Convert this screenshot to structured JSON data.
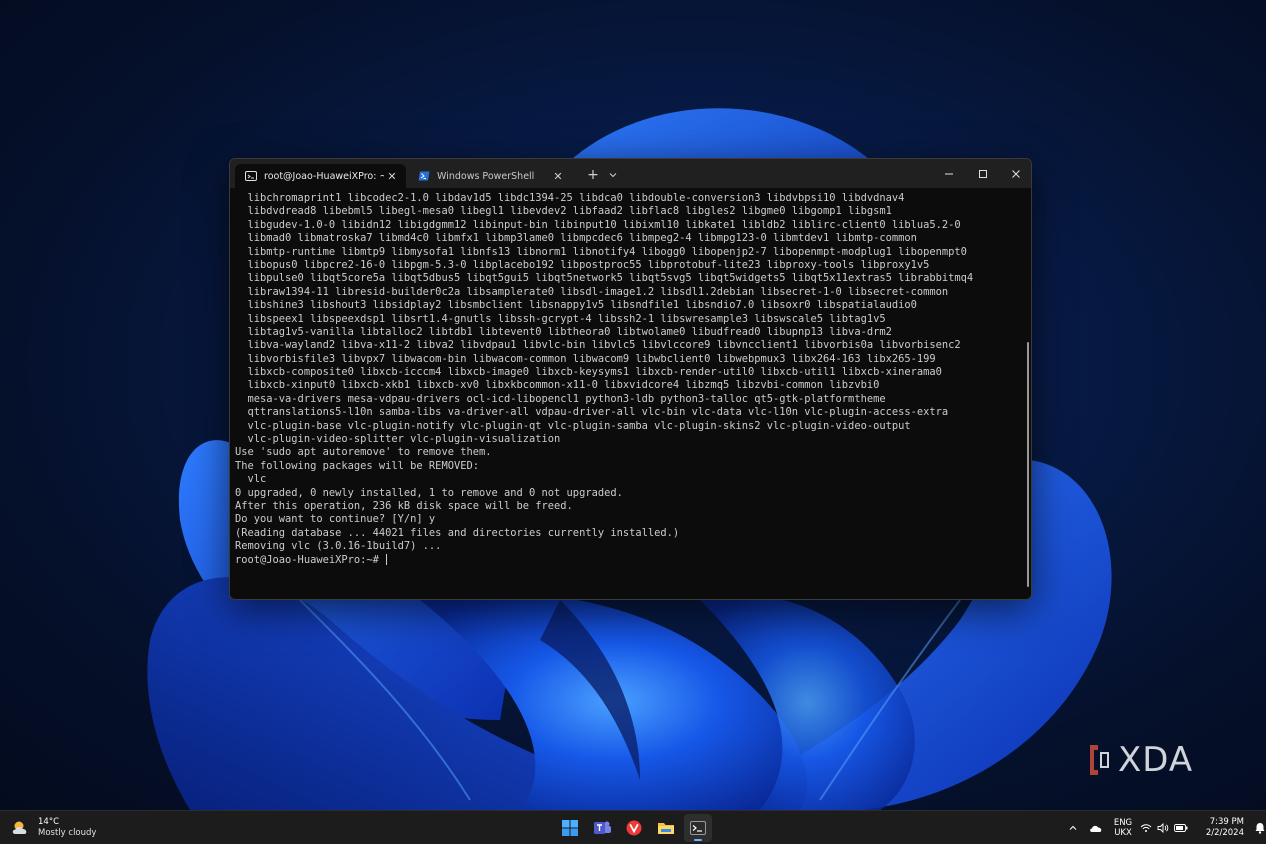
{
  "terminal": {
    "tabs": [
      {
        "label": "root@Joao-HuaweiXPro: ~",
        "active": true
      },
      {
        "label": "Windows PowerShell",
        "active": false
      }
    ],
    "new_tab_label": "+",
    "lines": [
      "  libchromaprint1 libcodec2-1.0 libdav1d5 libdc1394-25 libdca0 libdouble-conversion3 libdvbpsi10 libdvdnav4",
      "  libdvdread8 libebml5 libegl-mesa0 libegl1 libevdev2 libfaad2 libflac8 libgles2 libgme0 libgomp1 libgsm1",
      "  libgudev-1.0-0 libidn12 libigdgmm12 libinput-bin libinput10 libixml10 libkate1 libldb2 liblirc-client0 liblua5.2-0",
      "  libmad0 libmatroska7 libmd4c0 libmfx1 libmp3lame0 libmpcdec6 libmpeg2-4 libmpg123-0 libmtdev1 libmtp-common",
      "  libmtp-runtime libmtp9 libmysofa1 libnfs13 libnorm1 libnotify4 libogg0 libopenjp2-7 libopenmpt-modplug1 libopenmpt0",
      "  libopus0 libpcre2-16-0 libpgm-5.3-0 libplacebo192 libpostproc55 libprotobuf-lite23 libproxy-tools libproxy1v5",
      "  libpulse0 libqt5core5a libqt5dbus5 libqt5gui5 libqt5network5 libqt5svg5 libqt5widgets5 libqt5x11extras5 librabbitmq4",
      "  libraw1394-11 libresid-builder0c2a libsamplerate0 libsdl-image1.2 libsdl1.2debian libsecret-1-0 libsecret-common",
      "  libshine3 libshout3 libsidplay2 libsmbclient libsnappy1v5 libsndfile1 libsndio7.0 libsoxr0 libspatialaudio0",
      "  libspeex1 libspeexdsp1 libsrt1.4-gnutls libssh-gcrypt-4 libssh2-1 libswresample3 libswscale5 libtag1v5",
      "  libtag1v5-vanilla libtalloc2 libtdb1 libtevent0 libtheora0 libtwolame0 libudfread0 libupnp13 libva-drm2",
      "  libva-wayland2 libva-x11-2 libva2 libvdpau1 libvlc-bin libvlc5 libvlccore9 libvncclient1 libvorbis0a libvorbisenc2",
      "  libvorbisfile3 libvpx7 libwacom-bin libwacom-common libwacom9 libwbclient0 libwebpmux3 libx264-163 libx265-199",
      "  libxcb-composite0 libxcb-icccm4 libxcb-image0 libxcb-keysyms1 libxcb-render-util0 libxcb-util1 libxcb-xinerama0",
      "  libxcb-xinput0 libxcb-xkb1 libxcb-xv0 libxkbcommon-x11-0 libxvidcore4 libzmq5 libzvbi-common libzvbi0",
      "  mesa-va-drivers mesa-vdpau-drivers ocl-icd-libopencl1 python3-ldb python3-talloc qt5-gtk-platformtheme",
      "  qttranslations5-l10n samba-libs va-driver-all vdpau-driver-all vlc-bin vlc-data vlc-l10n vlc-plugin-access-extra",
      "  vlc-plugin-base vlc-plugin-notify vlc-plugin-qt vlc-plugin-samba vlc-plugin-skins2 vlc-plugin-video-output",
      "  vlc-plugin-video-splitter vlc-plugin-visualization",
      "Use 'sudo apt autoremove' to remove them.",
      "The following packages will be REMOVED:",
      "  vlc",
      "0 upgraded, 0 newly installed, 1 to remove and 0 not upgraded.",
      "After this operation, 236 kB disk space will be freed.",
      "Do you want to continue? [Y/n] y",
      "(Reading database ... 44021 files and directories currently installed.)",
      "Removing vlc (3.0.16-1build7) ...",
      "root@Joao-HuaweiXPro:~# "
    ]
  },
  "watermark": {
    "text": "XDA"
  },
  "taskbar": {
    "weather": {
      "temp": "14°C",
      "condition": "Mostly cloudy"
    },
    "language": {
      "line1": "ENG",
      "line2": "UKX"
    },
    "clock": {
      "time": "7:39 PM",
      "date": "2/2/2024"
    }
  },
  "colors": {
    "terminal_bg": "#0c0c0c",
    "titlebar_bg": "#202020",
    "text": "#cccccc",
    "taskbar_bg": "#1c1c1c",
    "accent": "#6fb2ff"
  }
}
